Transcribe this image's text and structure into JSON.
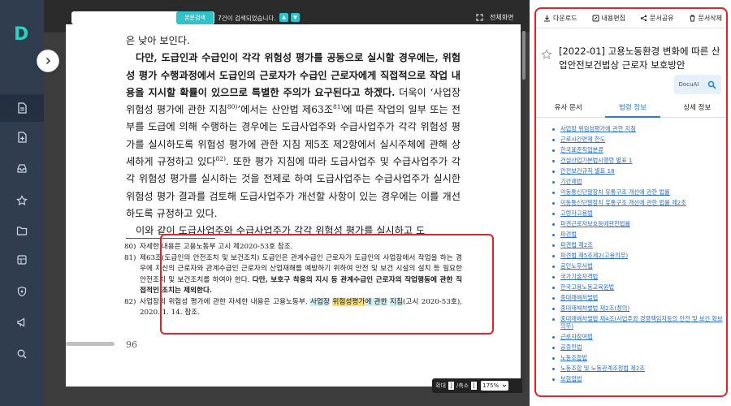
{
  "brand": {
    "logo": "D",
    "accent": "#2ad1c4"
  },
  "sidebar": {
    "items": [
      {
        "name": "nav-document-icon",
        "active": true
      },
      {
        "name": "nav-file-add-icon"
      },
      {
        "name": "nav-inbox-icon"
      },
      {
        "name": "nav-star-icon"
      },
      {
        "name": "nav-folder-icon"
      },
      {
        "name": "nav-box-icon"
      },
      {
        "name": "nav-shield-icon"
      },
      {
        "name": "nav-megaphone-icon"
      },
      {
        "name": "nav-search-icon"
      }
    ]
  },
  "viewer": {
    "search": {
      "value": "",
      "button_label": "본문검색",
      "status": "7건이 검색되었습니다."
    },
    "fullscreen_label": "전체화면",
    "body": {
      "line0": "은 낮아 보인다.",
      "p1_bold": "다만, 도급인과 수급인이 각각 위험성 평가를 공동으로 실시할 경우에는, 위험성 평가 수행과정에서 도급인의 근로자가 수급인 근로자에게 직접적으로 작업 내용을 지시할 확률이 있으므로 특별한 주의가 요구된다고 하겠다.",
      "p1_rest_a": " 더욱이 ‘사업장 위험성 평가에 관한 지침",
      "fn80": "80)",
      "p1_rest_b": "’에서는 산안법 제63조",
      "fn81": "81)",
      "p1_rest_c": "에 따른 작업의 일부 또는 전부를 도급에 의해 수행하는 경우에는 도급사업주와 수급사업주가 각각 위험성 평가를 실시하도록 위험성 평가에 관한 지침 제5조 제2항에서 실시주체에 관해 상세하게 규정하고 있다",
      "fn82": "82)",
      "p1_rest_d": ". 또한 평가 지침에 따라 도급사업주 및 수급사업주가 각각 위험성 평가를 실시하는 것을 전제로 하여 도급사업주는 수급사업주가 실시한 위험성 평가 결과를 검토해 도급사업주가 개선할 사항이 있는 경우에는 이를 개선하도록 규정하고 있다.",
      "p2": "이와 같이 도급사업주와 수급사업주가 각각 위험성 평가를 실시하고 도"
    },
    "footnotes": {
      "fn80": {
        "num": "80)",
        "text": "자세한 내용은 고용노동부 고시 제2020-53호 참조."
      },
      "fn81": {
        "num": "81)",
        "text": "제63조(도급인의 안전조치 및 보건조치) 도급인은 관계수급인 근로자가 도급인의 사업장에서 작업을 하는 경우에 자신의 근로자와 관계수급인 근로자의 산업재해를 예방하기 위하여 안전 및 보건 시설의 설치 등 필요한 안전조치 및 보건조치를 하여야 한다. ",
        "bold": "다만, 보호구 착용의 지시 등 관계수급인 근로자의 작업행동에 관한 직접적인 조치는 제외한다."
      },
      "fn82": {
        "num": "82)",
        "pre": "사업장의 위험성 평가에 관한 자세한 내용은 고용노동부, ",
        "hl1": "사업장",
        "sp": " ",
        "hl2": "위험성평가",
        "hl3": "에 관한",
        "br": " ",
        "hl4": "지침",
        "post": "(고시 2020-53호), 2020. 1. 14. 참조."
      }
    },
    "page_number": "96",
    "zoom": {
      "in_label": "확대",
      "out_label": "/축소",
      "in_box": "]",
      "out_box": "[",
      "value": "175%"
    }
  },
  "panel": {
    "toolbar": {
      "download": "다운로드",
      "edit": "내용편집",
      "share": "문서공유",
      "delete": "문서삭제"
    },
    "title": "[2022-01] 고용노동환경 변화에 따른 산업안전보건법상 근로자 보호방안",
    "docuai_label": "DocuAI",
    "tabs": [
      "유사 문서",
      "법령 정보",
      "상세 정보"
    ],
    "active_tab": 1,
    "laws": [
      "사업장 위험성평가에 관한 지침",
      "근로시간면제 한도",
      "한국표준직업분류",
      "건설산업기본법시행령 별표 1",
      "안전보건규칙 별표 18",
      "기간제법",
      "이동통신단말장치 유통구조 개선에 관한 법률",
      "이동통신단말장치 유통구조 개선에 관한 법률 제2조",
      "고령자고용법",
      "파견근로자보호등에관한법률",
      "파견법",
      "파견법 제2조",
      "파견법 제5조제2(고용의무)",
      "공인노무사법",
      "국가기술자격법",
      "한국고용노동교육원법",
      "중대재해처벌법",
      "중대재해처벌법 제2조(정의)",
      "중대재해처벌법 제4조(사업주와 경영책임자등의 안전 및 보건 확보 의무)",
      "근로자참여법",
      "공증인법",
      "노동조합법",
      "노동조합 및 노동관계조정법 제2조",
      "보험업법"
    ]
  },
  "colors": {
    "highlight_box": "#e0242a",
    "link": "#2a6fd0",
    "tab_active": "#2a7fd4"
  }
}
